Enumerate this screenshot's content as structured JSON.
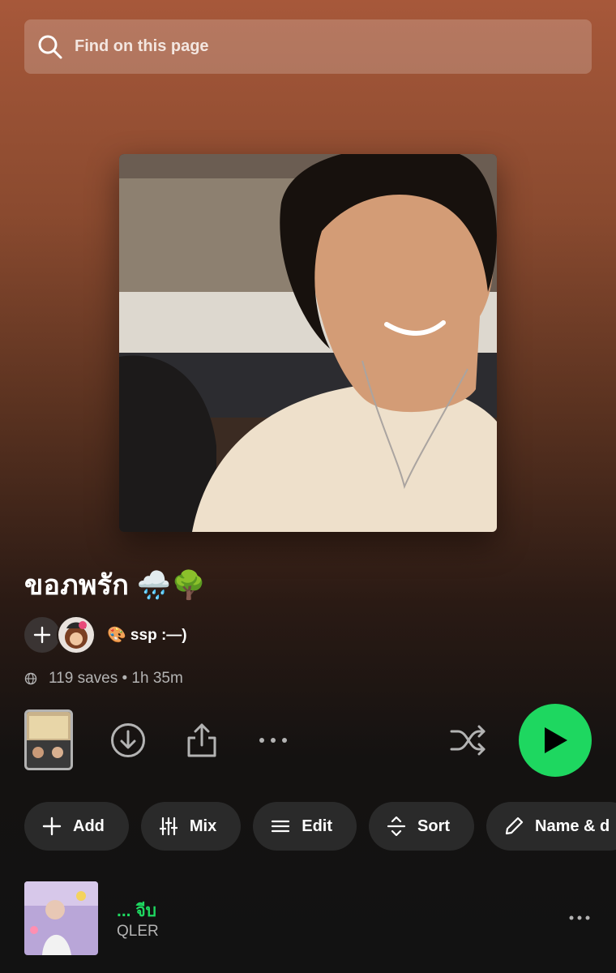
{
  "search": {
    "placeholder": "Find on this page"
  },
  "playlist": {
    "title": "ขอภพรัก 🌧️🌳",
    "owner_name": "🎨 ssp :—)",
    "meta": "119 saves • 1h 35m"
  },
  "chips": [
    {
      "label": "Add",
      "icon": "plus-icon"
    },
    {
      "label": "Mix",
      "icon": "sliders-icon"
    },
    {
      "label": "Edit",
      "icon": "lines-icon"
    },
    {
      "label": "Sort",
      "icon": "sort-icon"
    },
    {
      "label": "Name & d",
      "icon": "pencil-icon"
    }
  ],
  "tracks": [
    {
      "title": "... จีบ",
      "artist": "QLER"
    }
  ],
  "colors": {
    "accent": "#1ed760",
    "chip_bg": "#2a2a2a",
    "muted": "#b3b3b3"
  }
}
